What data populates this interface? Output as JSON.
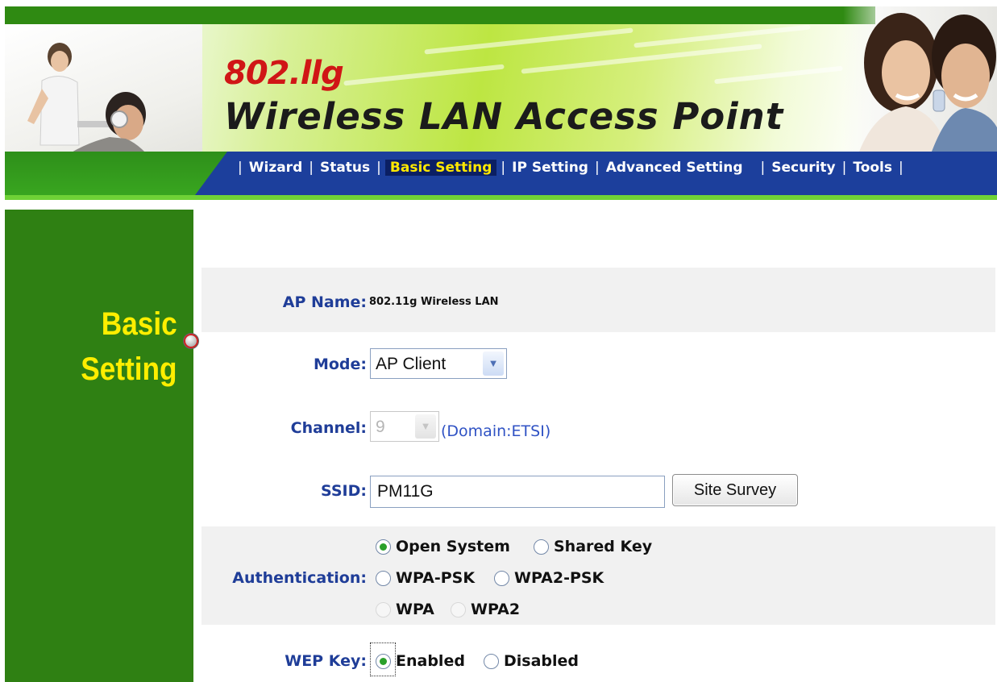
{
  "header": {
    "brand": "802.llg",
    "product_title": "Wireless LAN Access Point"
  },
  "nav": {
    "items": [
      {
        "label": "Wizard"
      },
      {
        "label": "Status"
      },
      {
        "label": "Basic Setting"
      },
      {
        "label": "IP Setting"
      },
      {
        "label": "Advanced Setting"
      },
      {
        "label": "Security"
      },
      {
        "label": "Tools"
      }
    ],
    "separator": "|",
    "active": "Basic Setting"
  },
  "sidebar": {
    "line1": "Basic",
    "line2": "Setting"
  },
  "form": {
    "ap_name": {
      "label": "AP Name:",
      "value": "802.11g Wireless LAN"
    },
    "mode": {
      "label": "Mode:",
      "value": "AP Client"
    },
    "channel": {
      "label": "Channel:",
      "value": "9",
      "domain": "(Domain:ETSI)"
    },
    "ssid": {
      "label": "SSID:",
      "value": "PM11G",
      "site_survey": "Site Survey"
    },
    "authentication": {
      "label": "Authentication:",
      "options": [
        "Open System",
        "Shared Key",
        "WPA-PSK",
        "WPA2-PSK",
        "WPA",
        "WPA2"
      ],
      "selected": "Open System"
    },
    "wep_key": {
      "label": "WEP Key:",
      "options": [
        "Enabled",
        "Disabled"
      ],
      "selected": "Enabled"
    }
  },
  "colors": {
    "green_dark": "#2f8013",
    "nav_blue": "#1c3f9c",
    "nav_active_bg": "#0b1f63",
    "nav_active_text": "#ffe800",
    "label_blue": "#1f3d98",
    "sidebar_text": "#ffee00",
    "brand_red": "#d01616"
  }
}
